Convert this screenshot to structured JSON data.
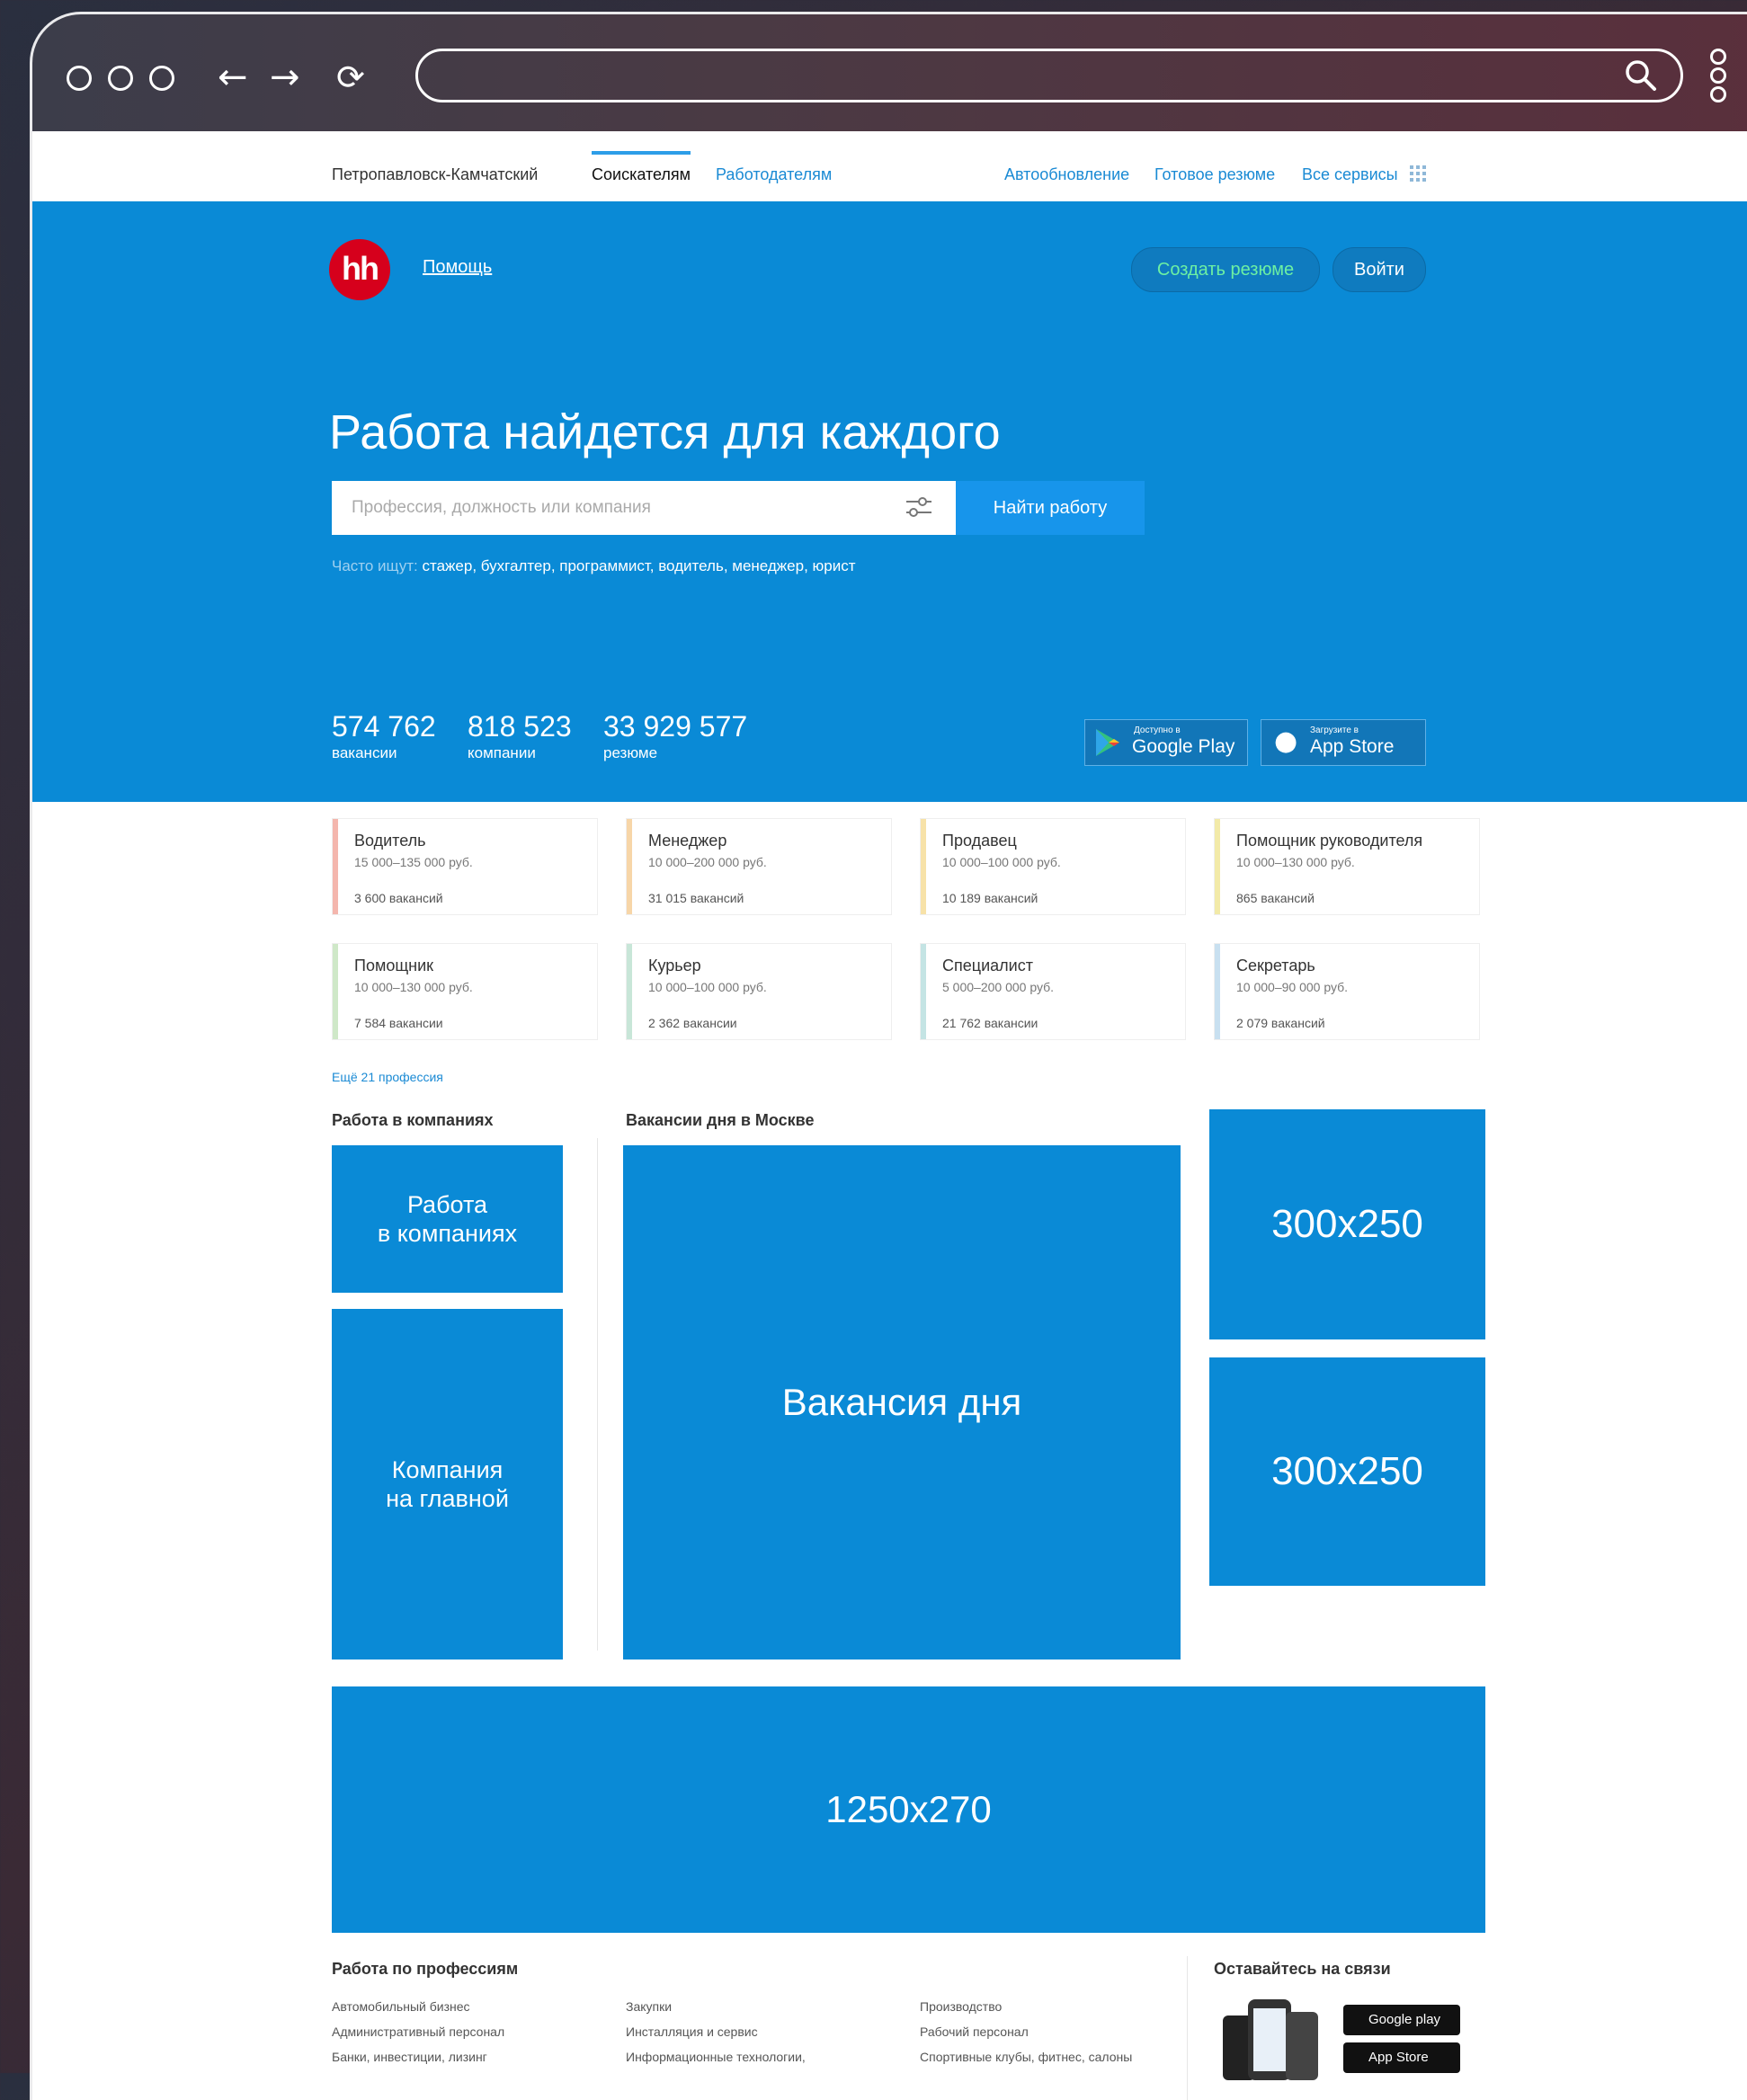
{
  "topnav": {
    "city": "Петропавловск-Камчатский",
    "tab_seekers": "Соискателям",
    "tab_employers": "Работодателям",
    "autoupdate": "Автообновление",
    "ready_resume": "Готовое резюме",
    "all_services": "Все сервисы"
  },
  "header": {
    "logo": "hh",
    "help": "Помощь",
    "create_resume": "Создать резюме",
    "login": "Войти"
  },
  "hero": {
    "headline": "Работа найдется для каждого",
    "search_placeholder": "Профессия, должность или компания",
    "find_button": "Найти работу",
    "often_prefix": "Часто ищут:",
    "often_terms": "стажер, бухгалтер, программист, водитель, менеджер, юрист"
  },
  "stats": [
    {
      "num": "574 762",
      "label": "вакансии"
    },
    {
      "num": "818 523",
      "label": "компании"
    },
    {
      "num": "33 929 577",
      "label": "резюме"
    }
  ],
  "stores": {
    "google_small": "Доступно в",
    "google_big": "Google Play",
    "apple_small": "Загрузите в",
    "apple_big": "App Store"
  },
  "professions": [
    {
      "title": "Водитель",
      "salary": "15 000–135 000 руб.",
      "count": "3 600 вакансий",
      "color": "#f4b6ad"
    },
    {
      "title": "Менеджер",
      "salary": "10 000–200 000 руб.",
      "count": "31 015 вакансий",
      "color": "#f7d6a8"
    },
    {
      "title": "Продавец",
      "salary": "10 000–100 000 руб.",
      "count": "10 189 вакансий",
      "color": "#f7e2a8"
    },
    {
      "title": "Помощник руководителя",
      "salary": "10 000–130 000 руб.",
      "count": "865 вакансий",
      "color": "#f2eaa8"
    },
    {
      "title": "Помощник",
      "salary": "10 000–130 000 руб.",
      "count": "7 584 вакансии",
      "color": "#cfe8c8"
    },
    {
      "title": "Курьер",
      "salary": "10 000–100 000 руб.",
      "count": "2 362 вакансии",
      "color": "#c8e6d8"
    },
    {
      "title": "Специалист",
      "salary": "5 000–200 000 руб.",
      "count": "21 762 вакансии",
      "color": "#c4e4e4"
    },
    {
      "title": "Секретарь",
      "salary": "10 000–90 000 руб.",
      "count": "2 079 вакансий",
      "color": "#c8e0f0"
    }
  ],
  "more_professions": "Ещё 21 профессия",
  "sections": {
    "companies_title": "Работа в компаниях",
    "vacancies_title": "Вакансии дня в Москве",
    "companies_block_line1": "Работа",
    "companies_block_line2": "в компаниях",
    "main_company_line1": "Компания",
    "main_company_line2": "на главной",
    "vacancy_day": "Вакансия дня",
    "ad_1": "300x250",
    "ad_2": "300x250",
    "banner": "1250x270"
  },
  "footer": {
    "by_profession_title": "Работа по профессиям",
    "stay_connected_title": "Оставайтесь на связи",
    "col1": [
      "Автомобильный бизнес",
      "Административный персонал",
      "Банки, инвестиции, лизинг"
    ],
    "col2": [
      "Закупки",
      "Инсталляция и сервис",
      "Информационные технологии,"
    ],
    "col3": [
      "Производство",
      "Рабочий персонал",
      "Спортивные клубы, фитнес, салоны"
    ],
    "mini_google": "Google play",
    "mini_apple": "App Store"
  }
}
